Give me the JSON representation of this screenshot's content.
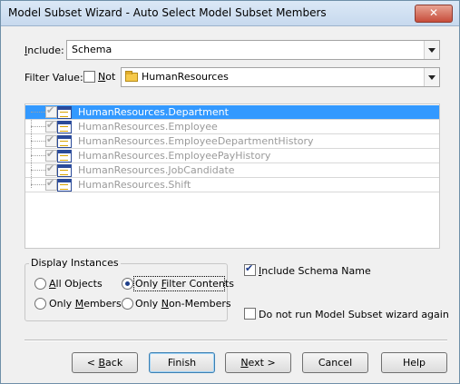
{
  "window": {
    "title": "Model Subset Wizard - Auto Select Model Subset Members",
    "close_label": "✕"
  },
  "include": {
    "label_prefix": "",
    "label_u": "I",
    "label_rest": "nclude:",
    "value": "Schema"
  },
  "filter": {
    "label": "Filter Value:",
    "not_u": "N",
    "not_rest": "ot",
    "not_checked": false,
    "value": "HumanResources"
  },
  "tree": {
    "items": [
      {
        "label": "HumanResources.Department",
        "selected": true
      },
      {
        "label": "HumanResources.Employee",
        "selected": false
      },
      {
        "label": "HumanResources.EmployeeDepartmentHistory",
        "selected": false
      },
      {
        "label": "HumanResources.EmployeePayHistory",
        "selected": false
      },
      {
        "label": "HumanResources.JobCandidate",
        "selected": false
      },
      {
        "label": "HumanResources.Shift",
        "selected": false
      }
    ]
  },
  "display_instances": {
    "title": "Display Instances",
    "all_u": "A",
    "all_rest": "ll Objects",
    "only_filter_pre": "Only ",
    "only_filter_u": "F",
    "only_filter_rest": "ilter Contents",
    "only_members_pre": "Only ",
    "only_members_u": "M",
    "only_members_rest": "embers",
    "only_nonmembers_pre": "Only ",
    "only_nonmembers_u": "N",
    "only_nonmembers_rest": "on-Members",
    "selected": "only_filter"
  },
  "options": {
    "include_schema_u": "I",
    "include_schema_rest": "nclude Schema Name",
    "include_schema_checked": true,
    "do_not_run": "Do not run Model Subset wizard again",
    "do_not_run_checked": false
  },
  "buttons": {
    "back_pre": "< ",
    "back_u": "B",
    "back_rest": "ack",
    "finish": "Finish",
    "next_u": "N",
    "next_rest": "ext >",
    "cancel": "Cancel",
    "help": "Help"
  }
}
